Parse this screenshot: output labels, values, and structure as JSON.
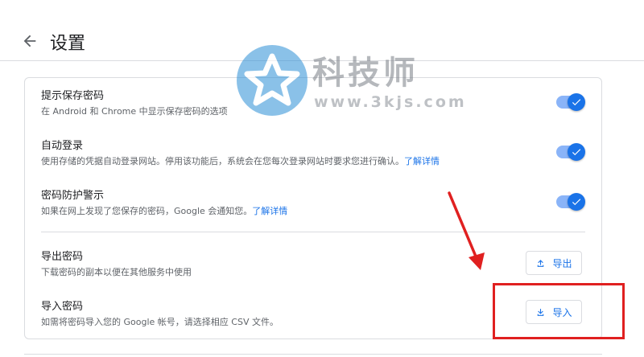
{
  "header": {
    "title": "设置",
    "back_icon": "arrow-left-icon"
  },
  "settings": {
    "offer_to_save": {
      "title": "提示保存密码",
      "subtitle": "在 Android 和 Chrome 中显示保存密码的选项",
      "enabled": true
    },
    "auto_signin": {
      "title": "自动登录",
      "subtitle": "使用存储的凭据自动登录网站。停用该功能后，系统会在您每次登录网站时要求您进行确认。",
      "link": "了解详情",
      "enabled": true
    },
    "leak_alerts": {
      "title": "密码防护警示",
      "subtitle": "如果在网上发现了您保存的密码，Google 会通知您。",
      "link": "了解详情",
      "enabled": true
    },
    "export": {
      "title": "导出密码",
      "subtitle": "下载密码的副本以便在其他服务中使用",
      "button_label": "导出",
      "icon": "upload-icon"
    },
    "import": {
      "title": "导入密码",
      "subtitle": "如需将密码导入您的 Google 帐号，请选择相应 CSV 文件。",
      "button_label": "导入",
      "icon": "download-icon"
    }
  },
  "watermark": {
    "title": "科技师",
    "url": "www.3kjs.com"
  },
  "colors": {
    "accent": "#1a73e8",
    "annotation": "#e02020"
  }
}
